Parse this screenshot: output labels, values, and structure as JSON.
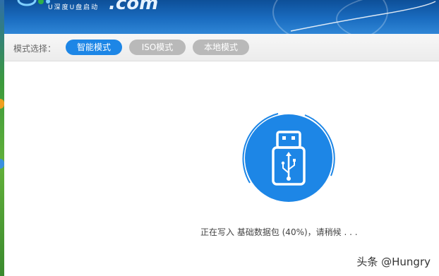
{
  "logo": {
    "subtitle": "U深度U盘启动",
    "domain": ".com"
  },
  "mode_bar": {
    "label": "模式选择：",
    "modes": [
      {
        "label": "智能模式",
        "active": true
      },
      {
        "label": "ISO模式",
        "active": false
      },
      {
        "label": "本地模式",
        "active": false
      }
    ]
  },
  "progress": {
    "status": "正在写入 基础数据包 (40%)，请稍候 . . .",
    "percent": 40
  },
  "watermark": "头条 @Hungry",
  "colors": {
    "accent": "#1d86e6",
    "inactive": "#b9b9b9",
    "banner": "#1a6cc0"
  },
  "icons": {
    "usb": "usb-drive-icon"
  }
}
